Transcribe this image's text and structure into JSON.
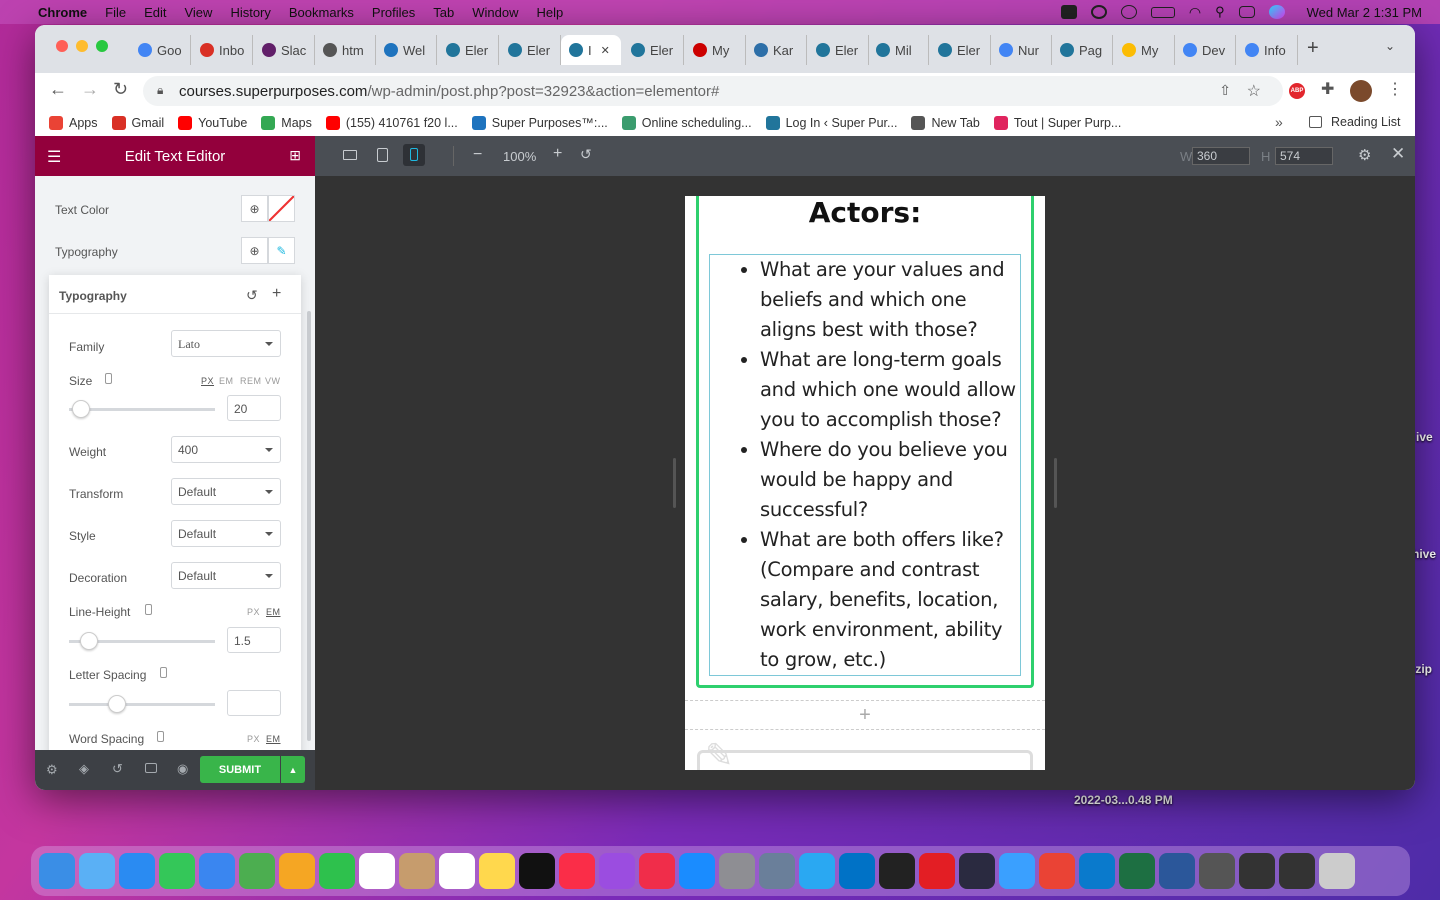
{
  "menubar": {
    "app": "Chrome",
    "items": [
      "File",
      "Edit",
      "View",
      "History",
      "Bookmarks",
      "Profiles",
      "Tab",
      "Window",
      "Help"
    ],
    "clock": "Wed Mar 2  1:31 PM"
  },
  "desktop": {
    "labels": [
      "ive",
      "hive",
      ".zip",
      "2022-03...0.48 PM"
    ]
  },
  "tabs": [
    {
      "label": "Goo",
      "color": "#4285f4"
    },
    {
      "label": "Inbo",
      "color": "#d93025"
    },
    {
      "label": "Slac",
      "color": "#611f69"
    },
    {
      "label": "htm",
      "color": "#555555"
    },
    {
      "label": "Wel",
      "color": "#1e73be"
    },
    {
      "label": "Eler",
      "color": "#21759b"
    },
    {
      "label": "Eler",
      "color": "#21759b"
    },
    {
      "label": "I",
      "color": "#21759b"
    },
    {
      "label": "Eler",
      "color": "#21759b"
    },
    {
      "label": "My",
      "color": "#cc0000"
    },
    {
      "label": "Kar",
      "color": "#2d6fa8"
    },
    {
      "label": "Eler",
      "color": "#21759b"
    },
    {
      "label": "Mil",
      "color": "#21759b"
    },
    {
      "label": "Eler",
      "color": "#21759b"
    },
    {
      "label": "Nur",
      "color": "#4285f4"
    },
    {
      "label": "Pag",
      "color": "#21759b"
    },
    {
      "label": "My",
      "color": "#fbbc04"
    },
    {
      "label": "Dev",
      "color": "#4285f4"
    },
    {
      "label": "Info",
      "color": "#4285f4"
    }
  ],
  "address": {
    "domain": "courses.superpurposes.com",
    "path": "/wp-admin/post.php?post=32923&action=elementor#"
  },
  "bookmarks": [
    {
      "label": "Apps",
      "color": "#ea4335"
    },
    {
      "label": "Gmail",
      "color": "#d93025"
    },
    {
      "label": "YouTube",
      "color": "#ff0000"
    },
    {
      "label": "Maps",
      "color": "#34a853"
    },
    {
      "label": "(155) 410761 f20 l...",
      "color": "#ff0000"
    },
    {
      "label": "Super Purposes™:...",
      "color": "#1e73be"
    },
    {
      "label": "Online scheduling...",
      "color": "#3b9c6e"
    },
    {
      "label": "Log In ‹ Super Pur...",
      "color": "#21759b"
    },
    {
      "label": "New Tab",
      "color": "#555555"
    },
    {
      "label": "Tout | Super Purp...",
      "color": "#e0245e"
    }
  ],
  "reading_list": "Reading List",
  "panel": {
    "title": "Edit Text Editor",
    "text_color_label": "Text Color",
    "typography_label": "Typography",
    "popover_title": "Typography",
    "family_label": "Family",
    "family_value": "Lato",
    "size_label": "Size",
    "size_units": [
      "PX",
      "EM",
      "REM",
      "VW"
    ],
    "size_value": "20",
    "size_level": 0.08,
    "weight_label": "Weight",
    "weight_value": "400",
    "transform_label": "Transform",
    "transform_value": "Default",
    "style_label": "Style",
    "style_value": "Default",
    "decoration_label": "Decoration",
    "decoration_value": "Default",
    "line_height_label": "Line-Height",
    "line_height_units": [
      "PX",
      "EM"
    ],
    "line_height_value": "1.5",
    "line_height_level": 0.14,
    "letter_spacing_label": "Letter Spacing",
    "letter_spacing_level": 0.33,
    "word_spacing_label": "Word Spacing",
    "word_spacing_units": [
      "PX",
      "EM"
    ],
    "submit": "SUBMIT"
  },
  "preview": {
    "zoom": "100%",
    "width": "360",
    "height": "574",
    "w_label": "W",
    "h_label": "H",
    "heading": "Actors:",
    "bullets": [
      "What are your values and beliefs and which one aligns best with those?",
      "What are long-term goals and which one would allow you to accomplish those?",
      "Where do you believe you would be happy and successful?",
      "What are both offers like? (Compare and contrast salary, benefits, location, work environment, ability to grow, etc.)"
    ]
  },
  "dock_colors": [
    "#3a8ee6",
    "#5ab0f5",
    "#2a8bf2",
    "#34c759",
    "#3a86f0",
    "#4cae50",
    "#f5a623",
    "#2ec14d",
    "#ffffff",
    "#c69c6d",
    "#ffffff",
    "#ffd84d",
    "#111111",
    "#fa2d48",
    "#9b4de0",
    "#f02d4a",
    "#1a8cff",
    "#8e8e93",
    "#6a7f9a",
    "#2aa8f2",
    "#0072c6",
    "#222222",
    "#e31e24",
    "#2a2a40",
    "#3aa0ff",
    "#ea4335",
    "#0a7acc",
    "#1d6f42",
    "#2b579a",
    "#555555",
    "#333333",
    "#333333",
    "#cccccc"
  ]
}
